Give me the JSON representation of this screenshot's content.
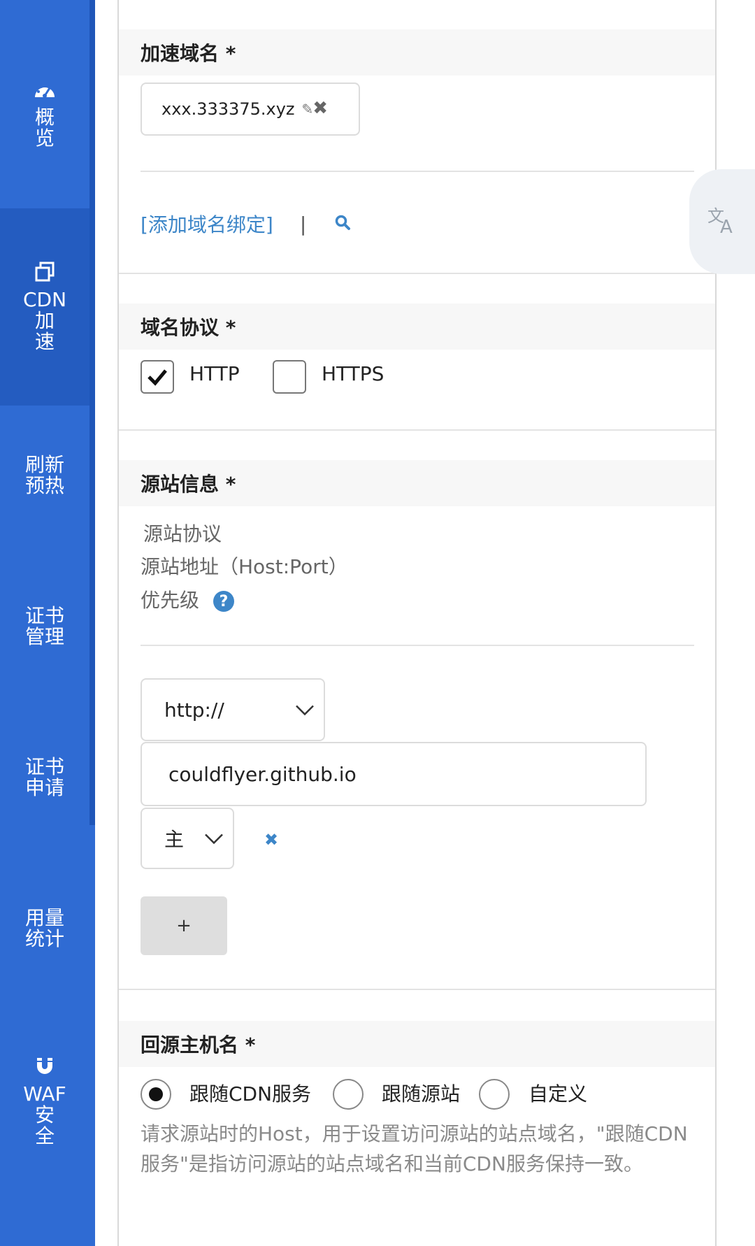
{
  "sidebar": {
    "items": [
      {
        "label": "概\n览",
        "icon": "dashboard-gauge-icon"
      },
      {
        "label": "CDN\n加\n速",
        "icon": "copy-windows-icon"
      },
      {
        "label": "刷新\n预热"
      },
      {
        "label": "证书\n管理"
      },
      {
        "label": "证书\n申请"
      },
      {
        "label": "用量\n统计"
      },
      {
        "label": "WAF\n安\n全",
        "icon": "magnet-icon"
      }
    ],
    "active": "CDN\n加\n速",
    "colors": {
      "background": "#2f6bd3",
      "active": "#245cc0"
    }
  },
  "form": {
    "domain_section": {
      "title": "加速域名 *",
      "domain": "xxx.333375.xyz",
      "add_link": "[添加域名绑定]",
      "separator": "|"
    },
    "protocol_section": {
      "title": "域名协议 *",
      "options": [
        {
          "label": "HTTP",
          "checked": true
        },
        {
          "label": "HTTPS",
          "checked": false
        }
      ]
    },
    "origin_section": {
      "title": "源站信息 *",
      "labels": {
        "protocol": "源站协议",
        "address": "源站地址（Host:Port）",
        "priority": "优先级"
      },
      "protocol_value": "http://",
      "address_value": "couldflyer.github.io",
      "priority_value": "主",
      "add_button": "+"
    },
    "host_section": {
      "title": "回源主机名 *",
      "options": [
        {
          "label": "跟随CDN服务",
          "checked": true
        },
        {
          "label": "跟随源站",
          "checked": false
        },
        {
          "label": "自定义",
          "checked": false
        }
      ],
      "description": "请求源站时的Host，用于设置访问源站的站点域名，\"跟随CDN服务\"是指访问源站的站点域名和当前CDN服务保持一致。"
    }
  },
  "colors": {
    "link": "#3d86c8",
    "section_bg": "#f7f7f7"
  }
}
